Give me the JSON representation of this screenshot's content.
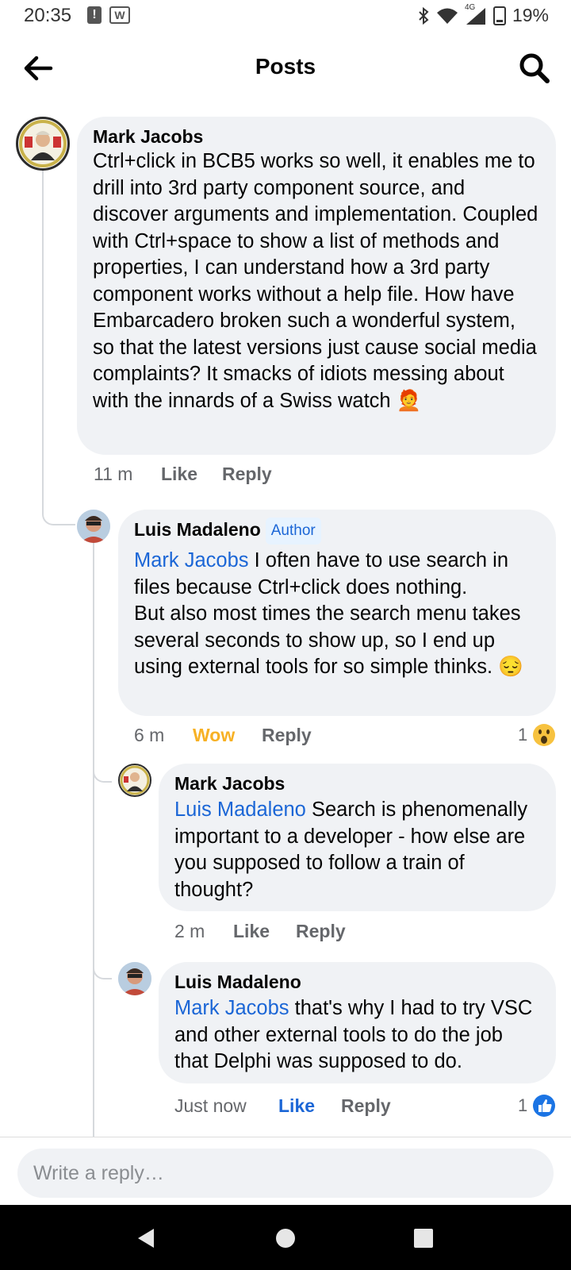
{
  "status_bar": {
    "time": "20:35",
    "battery": "19%",
    "network": "4G",
    "icons": [
      "alert-icon",
      "w-app-icon",
      "bluetooth-icon",
      "wifi-icon",
      "signal-icon",
      "battery-icon"
    ]
  },
  "header": {
    "title": "Posts"
  },
  "comments": [
    {
      "author": "Mark Jacobs",
      "text": "Ctrl+click in BCB5 works so well, it enables me to drill into 3rd party component source, and discover arguments and implementation. Coupled with Ctrl+space to show a list of methods and properties, I can understand how a 3rd party component works without a help file. How have Embarcadero broken such a wonderful system, so that the latest versions just cause social media complaints? It smacks of idiots messing about with the innards of a Swiss watch",
      "emoji": "🧑‍🦰",
      "time": "11 m",
      "like": "Like",
      "reply": "Reply"
    },
    {
      "author": "Luis Madaleno",
      "badge": "Author",
      "mention": "Mark Jacobs",
      "text": " I often have to use search in files because Ctrl+click does nothing.\nBut also most times the search menu takes several seconds to show up, so I end up using external tools for so simple thinks.",
      "emoji": "😔",
      "time": "6 m",
      "like": "Wow",
      "reply": "Reply",
      "reaction_count": "1",
      "reaction_icon": "wow-reaction-icon"
    },
    {
      "author": "Mark Jacobs",
      "mention": "Luis Madaleno",
      "text": " Search is phenomenally important to a developer - how else are you supposed to follow a train of thought?",
      "time": "2 m",
      "like": "Like",
      "reply": "Reply"
    },
    {
      "author": "Luis Madaleno",
      "mention": "Mark Jacobs",
      "text": " that's why I had to try VSC and other external tools to do the job that Delphi was supposed to do.",
      "time": "Just now",
      "like": "Like",
      "reply": "Reply",
      "reaction_count": "1",
      "reaction_icon": "like-reaction-icon"
    }
  ],
  "composer": {
    "placeholder": "Write a reply…"
  },
  "colors": {
    "mention": "#1b66d6",
    "wow": "#f7b125",
    "bubble": "#f0f2f5",
    "like_active": "#1b66d6"
  }
}
